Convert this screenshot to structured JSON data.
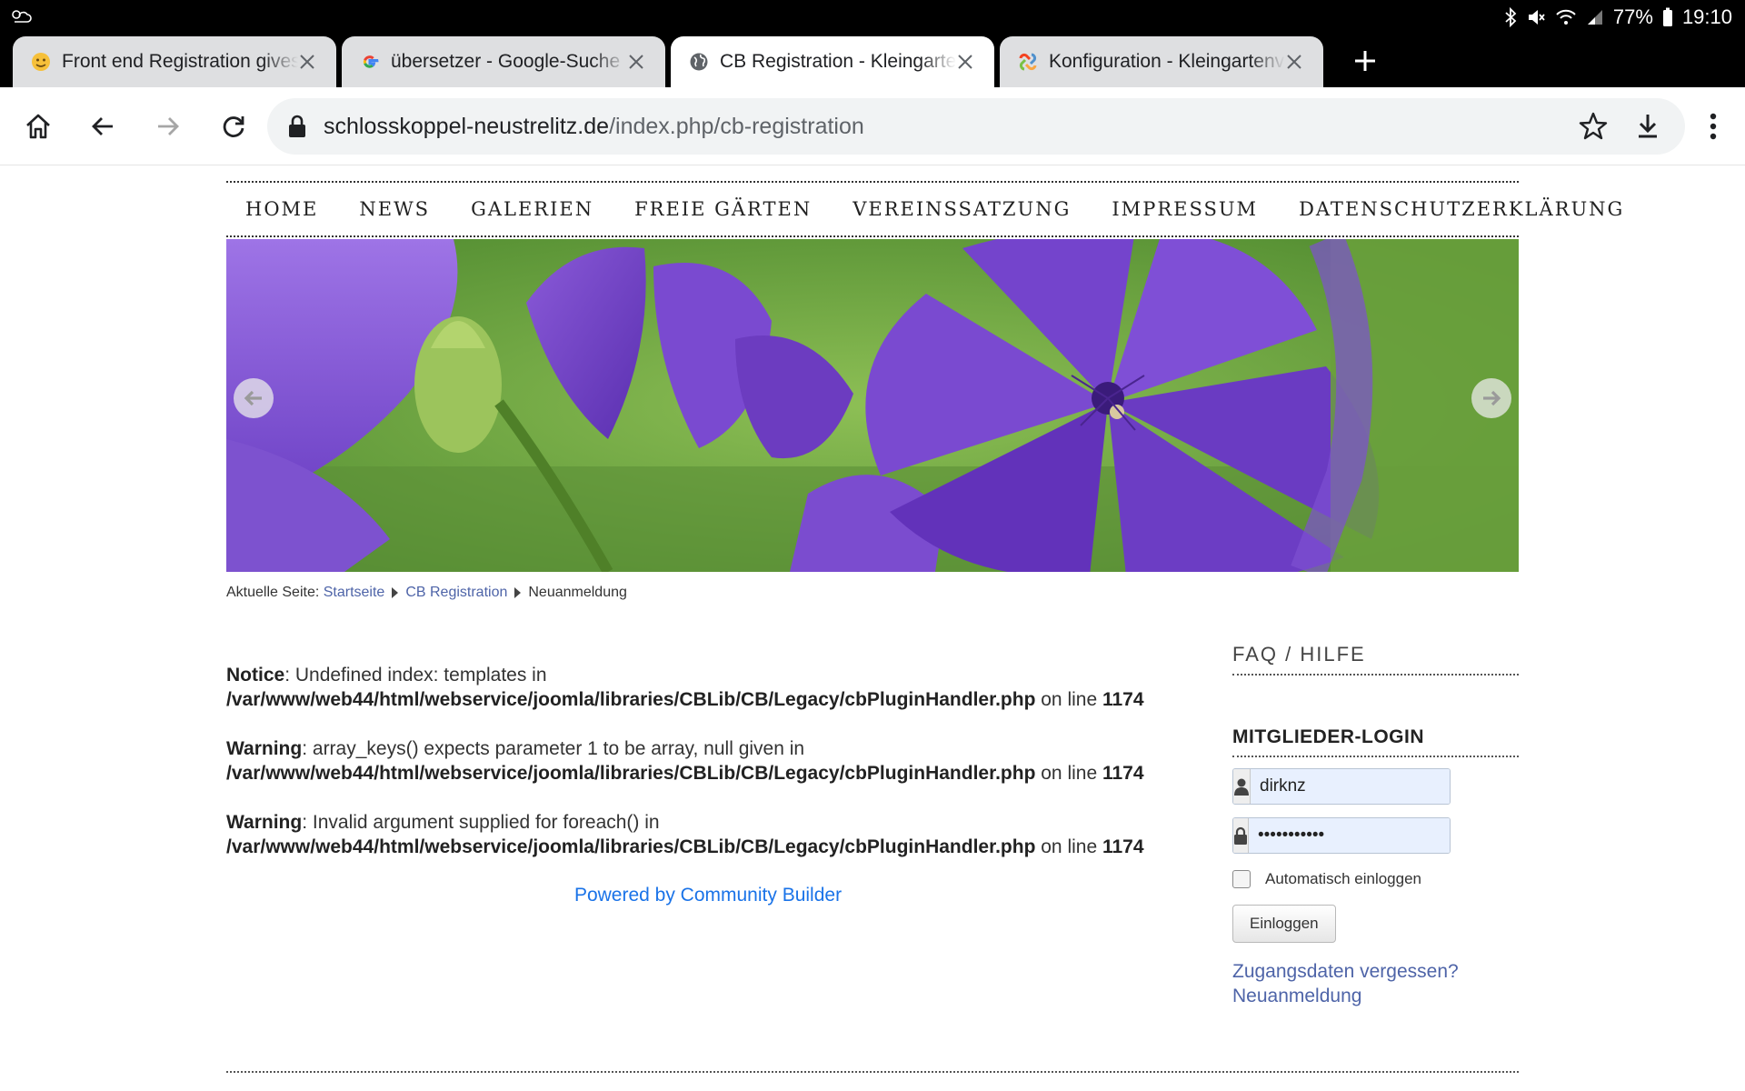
{
  "status_bar": {
    "battery_percent": "77%",
    "time": "19:10"
  },
  "tabs": [
    {
      "title": "Front end Registration gives",
      "favicon": "emoji-face-icon"
    },
    {
      "title": "übersetzer - Google-Suche",
      "favicon": "google-icon"
    },
    {
      "title": "CB Registration - Kleingarten",
      "favicon": "globe-icon",
      "active": true
    },
    {
      "title": "Konfiguration - Kleingartenve",
      "favicon": "joomla-icon"
    }
  ],
  "toolbar": {
    "url_host": "schlosskoppel-neustrelitz.de",
    "url_path": "/index.php/cb-registration"
  },
  "nav": {
    "items": [
      "HOME",
      "NEWS",
      "GALERIEN",
      "FREIE GÄRTEN",
      "VEREINSSATZUNG",
      "IMPRESSUM",
      "DATENSCHUTZERKLÄRUNG"
    ]
  },
  "breadcrumb": {
    "prefix": "Aktuelle Seite:",
    "links": [
      "Startseite",
      "CB Registration"
    ],
    "current": "Neuanmeldung"
  },
  "errors": [
    {
      "level": "Notice",
      "text": ": Undefined index: templates in",
      "path": "/var/www/web44/html/webservice/joomla/libraries/CBLib/CB/Legacy/cbPluginHandler.php",
      "online": " on line ",
      "line": "1174"
    },
    {
      "level": "Warning",
      "text": ": array_keys() expects parameter 1 to be array, null given in",
      "path": "/var/www/web44/html/webservice/joomla/libraries/CBLib/CB/Legacy/cbPluginHandler.php",
      "online": " on line ",
      "line": "1174"
    },
    {
      "level": "Warning",
      "text": ": Invalid argument supplied for foreach() in",
      "path": "/var/www/web44/html/webservice/joomla/libraries/CBLib/CB/Legacy/cbPluginHandler.php",
      "online": " on line ",
      "line": "1174"
    }
  ],
  "powered_by": "Powered by Community Builder",
  "sidebar": {
    "faq_title": "FAQ / HILFE",
    "login_title": "MITGLIEDER-LOGIN",
    "username_value": "dirknz",
    "password_value": "•••••••••••",
    "remember_label": "Automatisch einloggen",
    "remember_checked": false,
    "login_button": "Einloggen",
    "forgot_link": "Zugangsdaten vergessen?",
    "register_link": "Neuanmeldung"
  },
  "colors": {
    "link": "#4e64a8",
    "powered_link": "#1a73e8",
    "status_bar": "#000000",
    "active_tab": "#ffffff",
    "inactive_tab": "#dedfe1"
  }
}
